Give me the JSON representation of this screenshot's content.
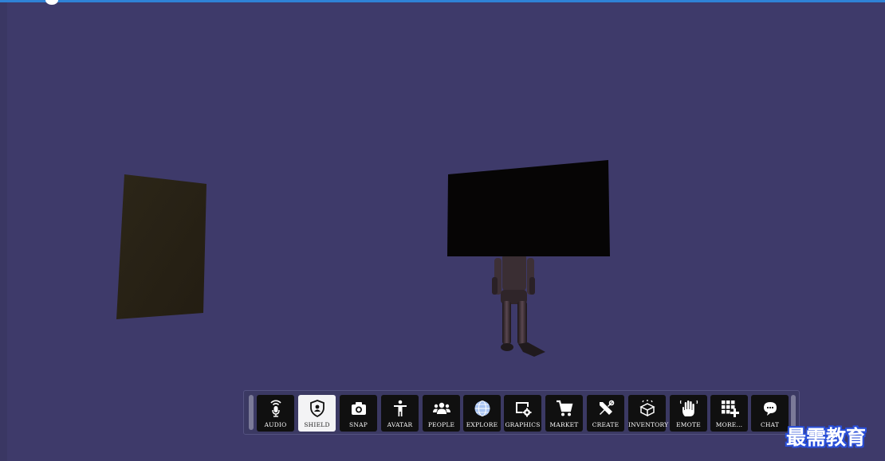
{
  "toolbar": {
    "items": [
      {
        "label": "AUDIO",
        "icon": "microphone-icon",
        "active": false
      },
      {
        "label": "SHIELD",
        "icon": "shield-icon",
        "active": true
      },
      {
        "label": "SNAP",
        "icon": "camera-icon",
        "active": false
      },
      {
        "label": "AVATAR",
        "icon": "person-icon",
        "active": false
      },
      {
        "label": "PEOPLE",
        "icon": "people-icon",
        "active": false
      },
      {
        "label": "EXPLORE",
        "icon": "globe-icon",
        "active": false
      },
      {
        "label": "GRAPHICS",
        "icon": "display-settings-icon",
        "active": false
      },
      {
        "label": "MARKET",
        "icon": "cart-icon",
        "active": false
      },
      {
        "label": "CREATE",
        "icon": "tools-icon",
        "active": false
      },
      {
        "label": "INVENTORY",
        "icon": "box-icon",
        "active": false
      },
      {
        "label": "EMOTE",
        "icon": "hand-wave-icon",
        "active": false
      },
      {
        "label": "MORE...",
        "icon": "grid-plus-icon",
        "active": false
      },
      {
        "label": "CHAT",
        "icon": "chat-bubble-icon",
        "active": false
      }
    ]
  },
  "watermark": {
    "text": "最需教育"
  },
  "colors": {
    "background": "#3e3a6a",
    "top_bar": "#2f82d6",
    "toolbar_button": "#101010",
    "toolbar_button_active": "#f3f3f5",
    "watermark_outline": "#2a4fd8"
  }
}
